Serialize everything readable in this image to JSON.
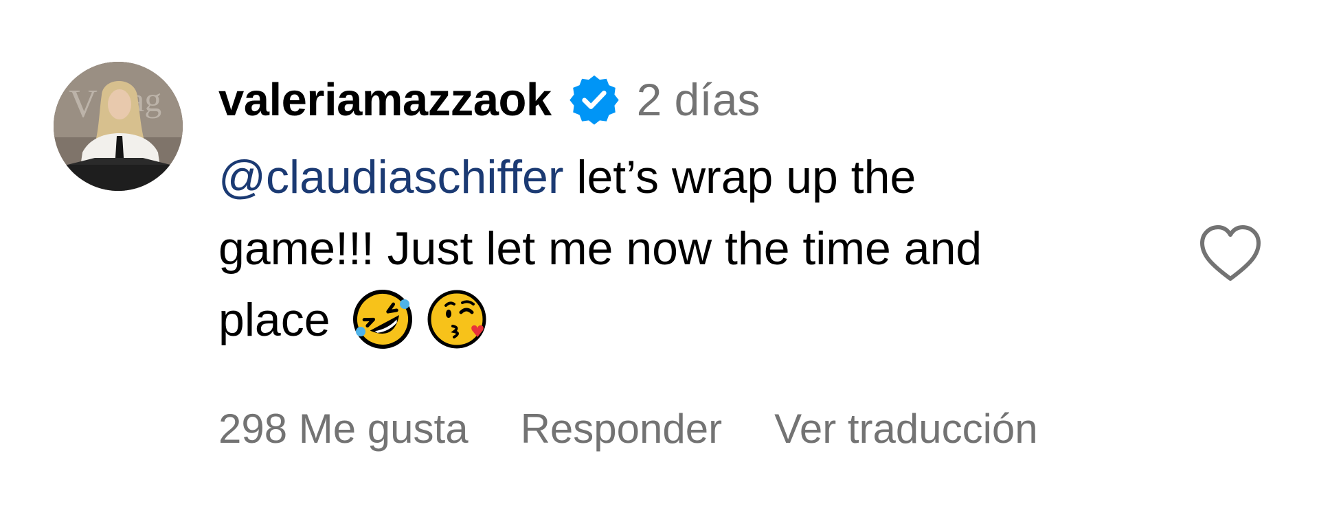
{
  "comment": {
    "username": "valeriamazzaok",
    "verified_icon": "verified-badge-icon",
    "timestamp": "2 días",
    "mention": "@claudiaschiffer",
    "text_line1_rest": " let’s wrap up the",
    "text_line2": "game!!! Just let me now the time and",
    "text_line3": "place",
    "emojis": [
      "rolling-on-floor-laughing-emoji",
      "face-blowing-kiss-emoji"
    ],
    "like_icon": "heart-outline-icon",
    "likes_label": "298 Me gusta",
    "reply_label": "Responder",
    "translate_label": "Ver traducción"
  },
  "colors": {
    "text": "#000000",
    "muted": "#737373",
    "mention": "#1b3a73",
    "verified": "#0095f6"
  }
}
